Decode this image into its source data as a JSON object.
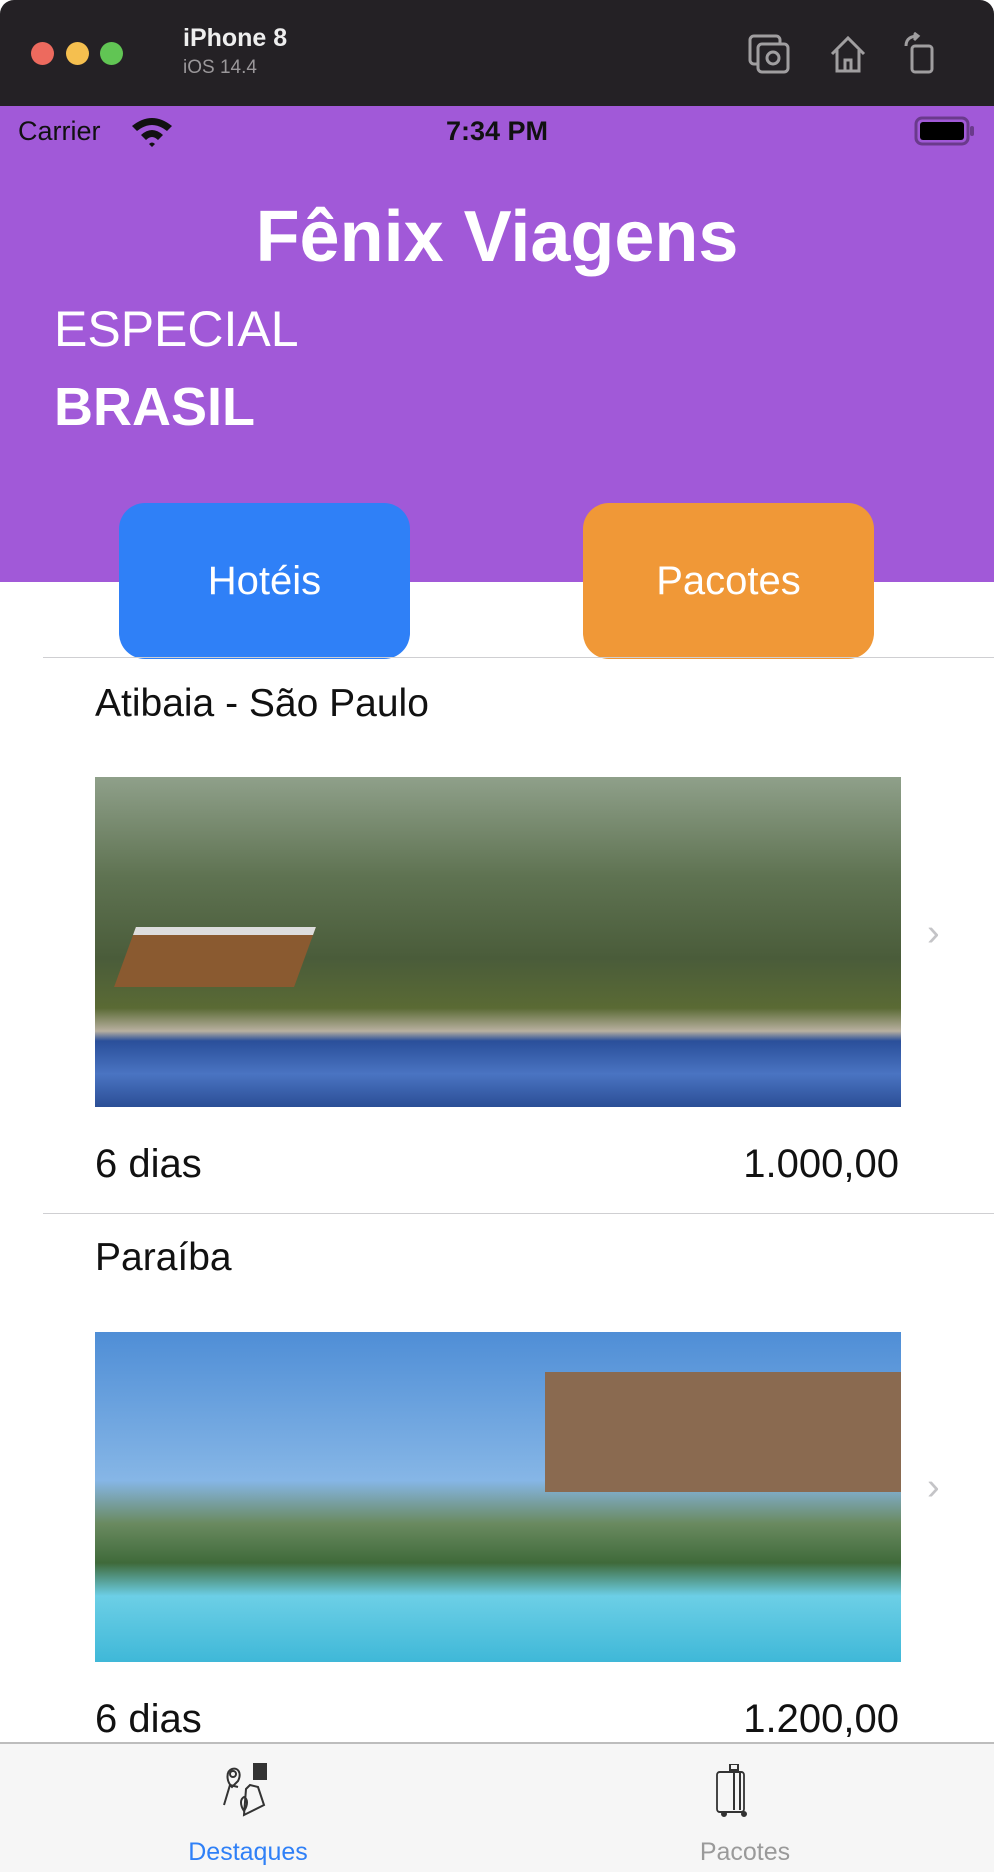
{
  "window": {
    "device": "iPhone 8",
    "os": "iOS 14.4",
    "colors": {
      "close": "#ed6a5e",
      "minimize": "#f5bf4f",
      "zoom": "#61c554"
    }
  },
  "status_bar": {
    "carrier": "Carrier",
    "time": "7:34 PM"
  },
  "header": {
    "title": "Fênix Viagens",
    "subtitle": "ESPECIAL",
    "region": "BRASIL",
    "color": "#a159d8"
  },
  "buttons": {
    "hotels": "Hotéis",
    "packages": "Pacotes",
    "hotels_color": "#2f80f7",
    "packages_color": "#f09837"
  },
  "list": [
    {
      "place": "Atibaia - São Paulo",
      "days": "6 dias",
      "price": "1.000,00"
    },
    {
      "place": "Paraíba",
      "days": "6 dias",
      "price": "1.200,00"
    }
  ],
  "tabbar": {
    "items": [
      {
        "label": "Destaques",
        "icon": "map-pins-icon",
        "active": true
      },
      {
        "label": "Pacotes",
        "icon": "suitcase-icon",
        "active": false
      }
    ]
  }
}
